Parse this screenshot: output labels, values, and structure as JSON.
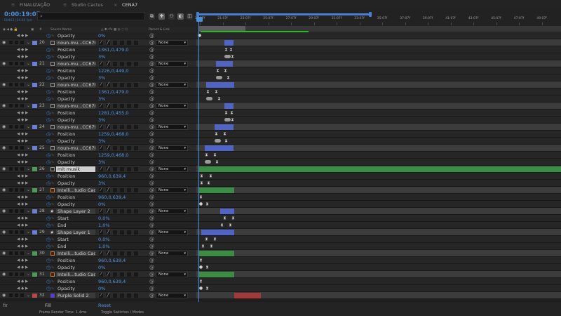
{
  "tabs": [
    {
      "label": "FINALIZAÇÃO",
      "active": false
    },
    {
      "label": "Studio Cactus",
      "active": false
    },
    {
      "label": "CENA7",
      "active": true
    }
  ],
  "timecode": "0:00:19:07",
  "fps_line": "00463 (24.00 fps)",
  "search": {
    "placeholder": ""
  },
  "columns": {
    "hash": "#",
    "source_name": "Source Name",
    "parent_link": "Parent & Link"
  },
  "ruler_ticks": [
    "19:07f",
    "21:07f",
    "23:07f",
    "25:07f",
    "27:07f",
    "29:07f",
    "31:07f",
    "33:07f",
    "35:07f",
    "37:07f",
    "39:07f",
    "41:07f",
    "43:07f",
    "45:07f",
    "47:07f",
    "49:07f"
  ],
  "accent": "#4a8fdc",
  "label_colors": {
    "blue": "#6b7fd6",
    "green": "#4f9a55",
    "purple": "#8a6bc7",
    "red": "#b64a4a"
  },
  "rows": [
    {
      "type": "prop",
      "name": "Opacity",
      "value": "0%",
      "kfs": [
        {
          "x": 2,
          "k": "dot"
        }
      ]
    },
    {
      "type": "layer",
      "num": "20",
      "icon": "file",
      "name": "noun-mu...CC67B.png",
      "label": "blue",
      "parent": "None",
      "clip": {
        "color": "blue",
        "start": 40,
        "end": 53
      }
    },
    {
      "type": "prop",
      "name": "Position",
      "value": "1361,0,479,0",
      "kfs": [
        {
          "x": 40,
          "k": "diamond"
        },
        {
          "x": 47,
          "k": "diamond"
        }
      ]
    },
    {
      "type": "prop",
      "name": "Opacity",
      "value": "3%",
      "kfs": [
        {
          "x": 40,
          "k": "pill"
        },
        {
          "x": 49,
          "k": "diamond"
        }
      ]
    },
    {
      "type": "layer",
      "num": "21",
      "icon": "file",
      "name": "noun-mu...CC67B.png",
      "label": "blue",
      "parent": "None",
      "clip": {
        "color": "blue",
        "start": 28,
        "end": 52
      }
    },
    {
      "type": "prop",
      "name": "Position",
      "value": "1226,0,449,0",
      "kfs": [
        {
          "x": 28,
          "k": "diamond"
        },
        {
          "x": 39,
          "k": "diamond"
        }
      ]
    },
    {
      "type": "prop",
      "name": "Opacity",
      "value": "3%",
      "kfs": [
        {
          "x": 28,
          "k": "pill"
        },
        {
          "x": 43,
          "k": "diamond"
        }
      ]
    },
    {
      "type": "layer",
      "num": "22",
      "icon": "file",
      "name": "noun-mu...CC67B.png",
      "label": "blue",
      "parent": "None",
      "clip": {
        "color": "blue",
        "start": 14,
        "end": 54
      }
    },
    {
      "type": "prop",
      "name": "Position",
      "value": "1361,0,479,0",
      "kfs": [
        {
          "x": 14,
          "k": "diamond"
        },
        {
          "x": 26,
          "k": "diamond"
        }
      ]
    },
    {
      "type": "prop",
      "name": "Opacity",
      "value": "3%",
      "kfs": [
        {
          "x": 14,
          "k": "pill"
        },
        {
          "x": 30,
          "k": "diamond"
        }
      ]
    },
    {
      "type": "layer",
      "num": "23",
      "icon": "file",
      "name": "noun-mu...CC67B.png",
      "label": "blue",
      "parent": "None",
      "clip": {
        "color": "blue",
        "start": 40,
        "end": 53
      }
    },
    {
      "type": "prop",
      "name": "Position",
      "value": "1281,0,455,0",
      "kfs": [
        {
          "x": 40,
          "k": "diamond"
        },
        {
          "x": 48,
          "k": "diamond"
        }
      ]
    },
    {
      "type": "prop",
      "name": "Opacity",
      "value": "3%",
      "kfs": [
        {
          "x": 40,
          "k": "pill"
        },
        {
          "x": 49,
          "k": "diamond"
        }
      ]
    },
    {
      "type": "layer",
      "num": "24",
      "icon": "file",
      "name": "noun-mu...CC67B.png",
      "label": "blue",
      "parent": "None",
      "clip": {
        "color": "blue",
        "start": 26,
        "end": 53
      }
    },
    {
      "type": "prop",
      "name": "Position",
      "value": "1259,0,468,0",
      "kfs": [
        {
          "x": 26,
          "k": "diamond"
        },
        {
          "x": 38,
          "k": "diamond"
        }
      ]
    },
    {
      "type": "prop",
      "name": "Opacity",
      "value": "3%",
      "kfs": [
        {
          "x": 26,
          "k": "pill"
        },
        {
          "x": 40,
          "k": "diamond"
        }
      ]
    },
    {
      "type": "layer",
      "num": "25",
      "icon": "file",
      "name": "noun-mu...CC67B.png",
      "label": "blue",
      "parent": "None",
      "clip": {
        "color": "blue",
        "start": 12,
        "end": 53
      }
    },
    {
      "type": "prop",
      "name": "Position",
      "value": "1259,0,468,0",
      "kfs": [
        {
          "x": 12,
          "k": "diamond"
        },
        {
          "x": 24,
          "k": "diamond"
        }
      ]
    },
    {
      "type": "prop",
      "name": "Opacity",
      "value": "3%",
      "kfs": [
        {
          "x": 12,
          "k": "pill"
        },
        {
          "x": 27,
          "k": "diamond"
        }
      ]
    },
    {
      "type": "layer",
      "num": "26",
      "icon": "audio",
      "name": "mit musik",
      "label": "green",
      "parent": "None",
      "highlight": true,
      "clip": {
        "color": "green",
        "start": 4,
        "end": 520
      }
    },
    {
      "type": "prop",
      "name": "Position",
      "value": "960,0,639,4",
      "kfs": [
        {
          "x": 5,
          "k": "diamond"
        },
        {
          "x": 18,
          "k": "diamond"
        }
      ]
    },
    {
      "type": "prop",
      "name": "Opacity",
      "value": "3%",
      "kfs": [
        {
          "x": 5,
          "k": "diamond"
        },
        {
          "x": 15,
          "k": "diamond"
        }
      ]
    },
    {
      "type": "layer",
      "num": "27",
      "icon": "ai",
      "name": "Intelli...tudio Cactus.ai",
      "label": "green",
      "parent": "None",
      "clip": {
        "color": "green",
        "start": 4,
        "end": 54
      }
    },
    {
      "type": "prop",
      "name": "Position",
      "value": "960,0,639,4",
      "kfs": [
        {
          "x": 4,
          "k": "diamond"
        }
      ]
    },
    {
      "type": "prop",
      "name": "Opacity",
      "value": "0%",
      "kfs": [
        {
          "x": 4,
          "k": "dot"
        },
        {
          "x": 13,
          "k": "diamond"
        }
      ]
    },
    {
      "type": "layer",
      "num": "28",
      "icon": "shape",
      "name": "Shape Layer 2",
      "label": "blue",
      "parent": "None",
      "clip": {
        "color": "blue",
        "start": 34,
        "end": 54
      }
    },
    {
      "type": "prop",
      "name": "Start",
      "value": "0,0%",
      "kfs": [
        {
          "x": 38,
          "k": "diamond"
        },
        {
          "x": 50,
          "k": "diamond"
        }
      ]
    },
    {
      "type": "prop",
      "name": "End",
      "value": "1,0%",
      "kfs": [
        {
          "x": 34,
          "k": "diamond"
        },
        {
          "x": 46,
          "k": "diamond"
        }
      ]
    },
    {
      "type": "layer",
      "num": "29",
      "icon": "shape",
      "name": "Shape Layer 1",
      "label": "blue",
      "parent": "None",
      "clip": {
        "color": "blue",
        "start": 7,
        "end": 54
      }
    },
    {
      "type": "prop",
      "name": "Start",
      "value": "0,0%",
      "kfs": [
        {
          "x": 12,
          "k": "diamond"
        },
        {
          "x": 24,
          "k": "diamond"
        }
      ]
    },
    {
      "type": "prop",
      "name": "End",
      "value": "1,0%",
      "kfs": [
        {
          "x": 7,
          "k": "diamond"
        },
        {
          "x": 19,
          "k": "diamond"
        }
      ]
    },
    {
      "type": "layer",
      "num": "30",
      "icon": "ai",
      "name": "Intelli...tudio Cactus.ai",
      "label": "green",
      "parent": "None",
      "clip": {
        "color": "green",
        "start": 4,
        "end": 54
      }
    },
    {
      "type": "prop",
      "name": "Position",
      "value": "960,0,639,4",
      "kfs": [
        {
          "x": 4,
          "k": "diamond"
        }
      ]
    },
    {
      "type": "prop",
      "name": "Opacity",
      "value": "0%",
      "kfs": [
        {
          "x": 4,
          "k": "dot"
        },
        {
          "x": 13,
          "k": "diamond"
        }
      ]
    },
    {
      "type": "layer",
      "num": "31",
      "icon": "ai",
      "name": "Intelli...tudio Cactus.ai",
      "label": "green",
      "parent": "None",
      "clip": {
        "color": "green",
        "start": 4,
        "end": 54
      }
    },
    {
      "type": "prop",
      "name": "Position",
      "value": "960,0,639,4",
      "kfs": [
        {
          "x": 4,
          "k": "diamond"
        }
      ]
    },
    {
      "type": "prop",
      "name": "Opacity",
      "value": "0%",
      "kfs": [
        {
          "x": 4,
          "k": "dot"
        },
        {
          "x": 13,
          "k": "diamond"
        }
      ]
    },
    {
      "type": "layer",
      "num": "32",
      "icon": "solid",
      "name": "Purple Solid 2",
      "label": "red",
      "parent": "None",
      "clip": {
        "color": "red",
        "start": 54,
        "end": 92
      }
    }
  ],
  "fx_row": {
    "label": "Fill",
    "value": "Reset"
  },
  "status": {
    "render_label": "Frame Render Time",
    "render_value": "1.4ms",
    "toggle": "Toggle Switches / Modes"
  }
}
